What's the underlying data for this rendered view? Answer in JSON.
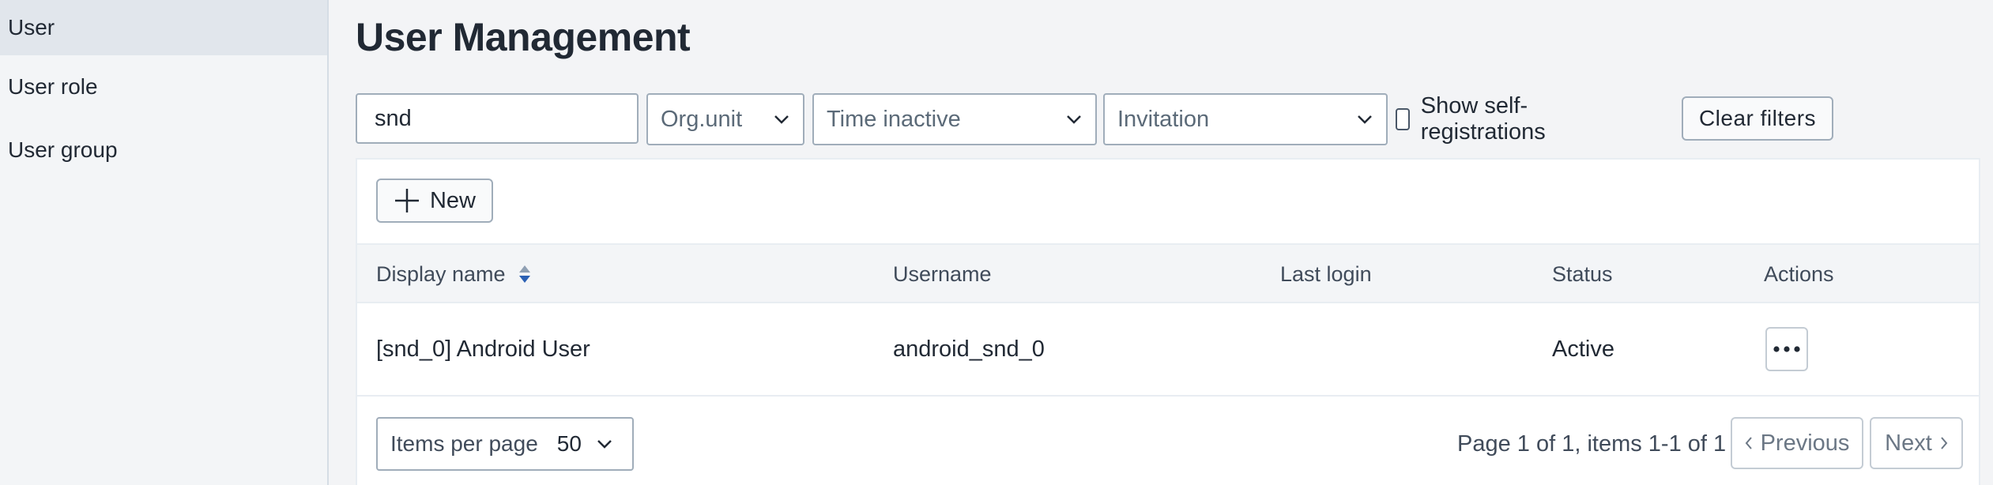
{
  "sidebar": {
    "items": [
      {
        "label": "User",
        "active": true
      },
      {
        "label": "User role",
        "active": false
      },
      {
        "label": "User group",
        "active": false
      }
    ]
  },
  "page": {
    "title": "User Management"
  },
  "filters": {
    "search_value": "snd",
    "org_unit_placeholder": "Org.unit",
    "time_inactive_placeholder": "Time inactive",
    "invitation_placeholder": "Invitation",
    "self_registrations_label": "Show self-registrations",
    "self_registrations_checked": false,
    "clear_label": "Clear filters"
  },
  "toolbar": {
    "new_label": "New"
  },
  "table": {
    "columns": [
      "Display name",
      "Username",
      "Last login",
      "Status",
      "Actions"
    ],
    "sort": {
      "column": "Display name"
    },
    "rows": [
      {
        "display_name": "[snd_0] Android User",
        "username": "android_snd_0",
        "last_login": "",
        "status": "Active"
      }
    ]
  },
  "pagination": {
    "items_per_page_label": "Items per page",
    "items_per_page_value": "50",
    "summary": "Page 1 of 1, items 1-1 of 1",
    "previous_label": "Previous",
    "next_label": "Next"
  },
  "icons": {
    "chevron": "chevron-down-icon",
    "plus": "plus-icon",
    "sort": "sort-icon",
    "more": "more-horizontal-icon"
  },
  "colors": {
    "accent": "#2b61b4",
    "text": "#212934",
    "border": "#a0adba"
  }
}
